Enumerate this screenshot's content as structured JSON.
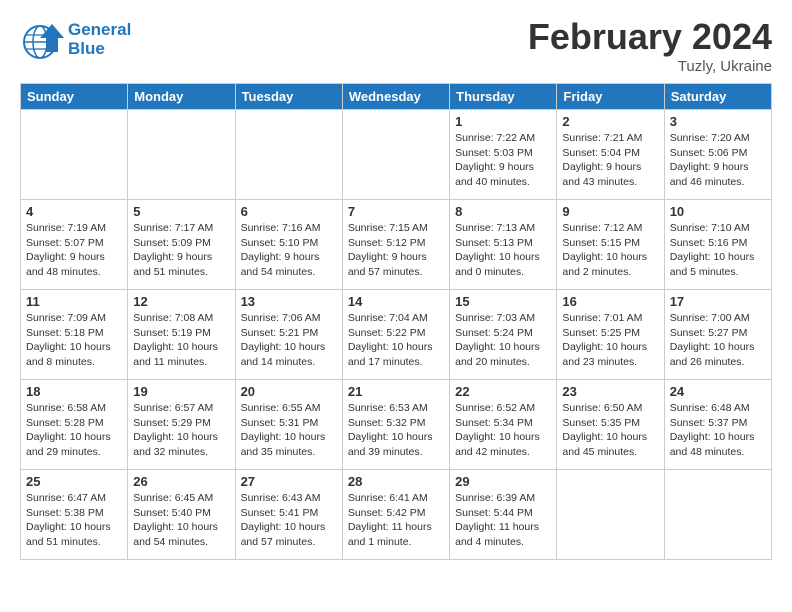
{
  "header": {
    "logo_line1": "General",
    "logo_line2": "Blue",
    "month_year": "February 2024",
    "location": "Tuzly, Ukraine"
  },
  "weekdays": [
    "Sunday",
    "Monday",
    "Tuesday",
    "Wednesday",
    "Thursday",
    "Friday",
    "Saturday"
  ],
  "weeks": [
    [
      {
        "day": "",
        "detail": ""
      },
      {
        "day": "",
        "detail": ""
      },
      {
        "day": "",
        "detail": ""
      },
      {
        "day": "",
        "detail": ""
      },
      {
        "day": "1",
        "detail": "Sunrise: 7:22 AM\nSunset: 5:03 PM\nDaylight: 9 hours\nand 40 minutes."
      },
      {
        "day": "2",
        "detail": "Sunrise: 7:21 AM\nSunset: 5:04 PM\nDaylight: 9 hours\nand 43 minutes."
      },
      {
        "day": "3",
        "detail": "Sunrise: 7:20 AM\nSunset: 5:06 PM\nDaylight: 9 hours\nand 46 minutes."
      }
    ],
    [
      {
        "day": "4",
        "detail": "Sunrise: 7:19 AM\nSunset: 5:07 PM\nDaylight: 9 hours\nand 48 minutes."
      },
      {
        "day": "5",
        "detail": "Sunrise: 7:17 AM\nSunset: 5:09 PM\nDaylight: 9 hours\nand 51 minutes."
      },
      {
        "day": "6",
        "detail": "Sunrise: 7:16 AM\nSunset: 5:10 PM\nDaylight: 9 hours\nand 54 minutes."
      },
      {
        "day": "7",
        "detail": "Sunrise: 7:15 AM\nSunset: 5:12 PM\nDaylight: 9 hours\nand 57 minutes."
      },
      {
        "day": "8",
        "detail": "Sunrise: 7:13 AM\nSunset: 5:13 PM\nDaylight: 10 hours\nand 0 minutes."
      },
      {
        "day": "9",
        "detail": "Sunrise: 7:12 AM\nSunset: 5:15 PM\nDaylight: 10 hours\nand 2 minutes."
      },
      {
        "day": "10",
        "detail": "Sunrise: 7:10 AM\nSunset: 5:16 PM\nDaylight: 10 hours\nand 5 minutes."
      }
    ],
    [
      {
        "day": "11",
        "detail": "Sunrise: 7:09 AM\nSunset: 5:18 PM\nDaylight: 10 hours\nand 8 minutes."
      },
      {
        "day": "12",
        "detail": "Sunrise: 7:08 AM\nSunset: 5:19 PM\nDaylight: 10 hours\nand 11 minutes."
      },
      {
        "day": "13",
        "detail": "Sunrise: 7:06 AM\nSunset: 5:21 PM\nDaylight: 10 hours\nand 14 minutes."
      },
      {
        "day": "14",
        "detail": "Sunrise: 7:04 AM\nSunset: 5:22 PM\nDaylight: 10 hours\nand 17 minutes."
      },
      {
        "day": "15",
        "detail": "Sunrise: 7:03 AM\nSunset: 5:24 PM\nDaylight: 10 hours\nand 20 minutes."
      },
      {
        "day": "16",
        "detail": "Sunrise: 7:01 AM\nSunset: 5:25 PM\nDaylight: 10 hours\nand 23 minutes."
      },
      {
        "day": "17",
        "detail": "Sunrise: 7:00 AM\nSunset: 5:27 PM\nDaylight: 10 hours\nand 26 minutes."
      }
    ],
    [
      {
        "day": "18",
        "detail": "Sunrise: 6:58 AM\nSunset: 5:28 PM\nDaylight: 10 hours\nand 29 minutes."
      },
      {
        "day": "19",
        "detail": "Sunrise: 6:57 AM\nSunset: 5:29 PM\nDaylight: 10 hours\nand 32 minutes."
      },
      {
        "day": "20",
        "detail": "Sunrise: 6:55 AM\nSunset: 5:31 PM\nDaylight: 10 hours\nand 35 minutes."
      },
      {
        "day": "21",
        "detail": "Sunrise: 6:53 AM\nSunset: 5:32 PM\nDaylight: 10 hours\nand 39 minutes."
      },
      {
        "day": "22",
        "detail": "Sunrise: 6:52 AM\nSunset: 5:34 PM\nDaylight: 10 hours\nand 42 minutes."
      },
      {
        "day": "23",
        "detail": "Sunrise: 6:50 AM\nSunset: 5:35 PM\nDaylight: 10 hours\nand 45 minutes."
      },
      {
        "day": "24",
        "detail": "Sunrise: 6:48 AM\nSunset: 5:37 PM\nDaylight: 10 hours\nand 48 minutes."
      }
    ],
    [
      {
        "day": "25",
        "detail": "Sunrise: 6:47 AM\nSunset: 5:38 PM\nDaylight: 10 hours\nand 51 minutes."
      },
      {
        "day": "26",
        "detail": "Sunrise: 6:45 AM\nSunset: 5:40 PM\nDaylight: 10 hours\nand 54 minutes."
      },
      {
        "day": "27",
        "detail": "Sunrise: 6:43 AM\nSunset: 5:41 PM\nDaylight: 10 hours\nand 57 minutes."
      },
      {
        "day": "28",
        "detail": "Sunrise: 6:41 AM\nSunset: 5:42 PM\nDaylight: 11 hours\nand 1 minute."
      },
      {
        "day": "29",
        "detail": "Sunrise: 6:39 AM\nSunset: 5:44 PM\nDaylight: 11 hours\nand 4 minutes."
      },
      {
        "day": "",
        "detail": ""
      },
      {
        "day": "",
        "detail": ""
      }
    ]
  ]
}
